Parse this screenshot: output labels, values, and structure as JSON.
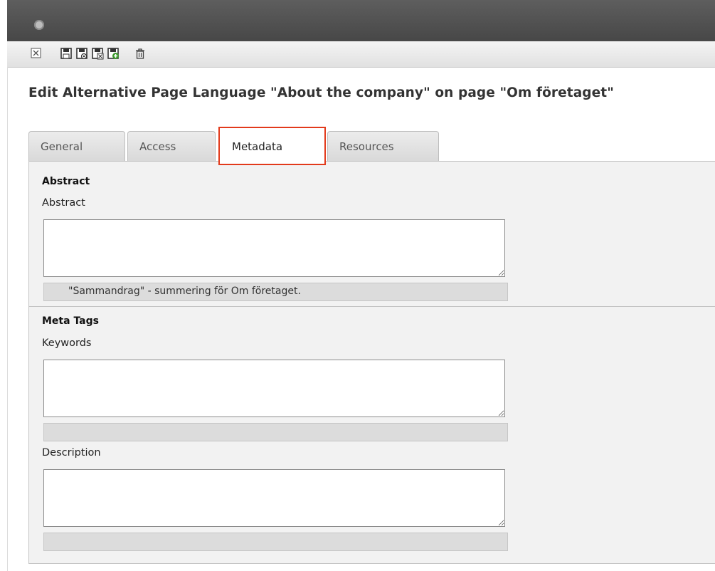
{
  "page_title": "Edit Alternative Page Language \"About the company\" on page \"Om företaget\"",
  "tabs": [
    {
      "label": "General"
    },
    {
      "label": "Access"
    },
    {
      "label": "Metadata",
      "active": true
    },
    {
      "label": "Resources"
    }
  ],
  "toolbar": {
    "icons": [
      "close-icon",
      "save-icon",
      "save-view-icon",
      "save-close-icon",
      "save-new-icon",
      "delete-icon"
    ]
  },
  "sections": {
    "abstract": {
      "heading": "Abstract",
      "field_label": "Abstract",
      "value": "",
      "hint": "\"Sammandrag\" - summering för Om företaget."
    },
    "meta_tags": {
      "heading": "Meta Tags",
      "keywords_label": "Keywords",
      "keywords_value": "",
      "keywords_hint": "",
      "description_label": "Description",
      "description_value": "",
      "description_hint": ""
    }
  },
  "colors": {
    "active_tab_outline": "#e23a1b",
    "topbar": "#555555",
    "panel_bg": "#f2f2f2"
  }
}
